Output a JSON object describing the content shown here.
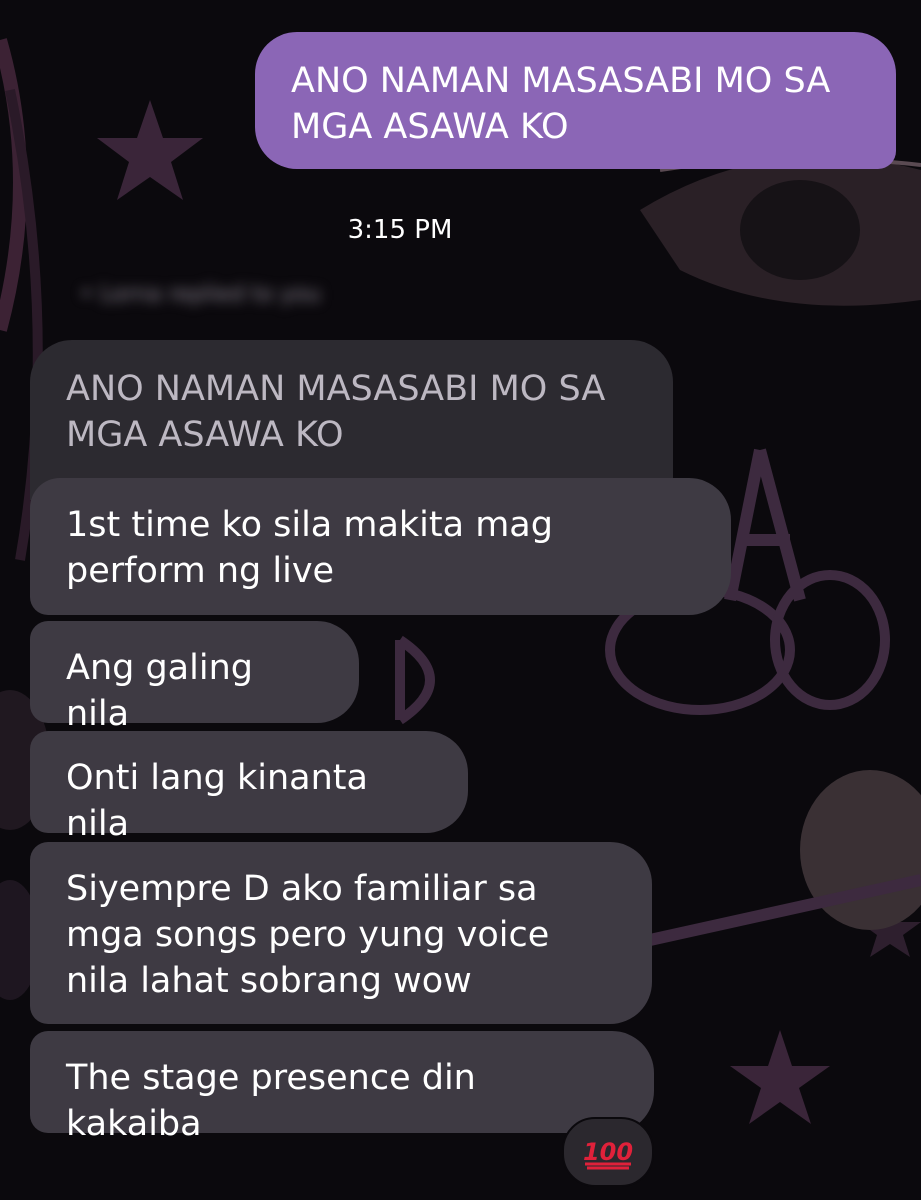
{
  "sent_message": "ANO NAMAN MASASABI MO SA MGA ASAWA KO",
  "timestamp": "3:15 PM",
  "reply_context": {
    "name_blurred": "• Lorna replied to you",
    "quoted_text": "ANO NAMAN MASASABI MO SA MGA ASAWA KO"
  },
  "received_messages": [
    "1st time ko sila makita mag perform ng live",
    "Ang galing nila",
    "Onti lang kinanta nila",
    "Siyempre D ako familiar sa mga songs pero yung voice nila lahat sobrang wow",
    "The stage presence din kakaiba"
  ],
  "reaction": {
    "icon": "hundred-points-icon",
    "text": "100"
  },
  "colors": {
    "sent_bubble": "#8b66b6",
    "received_bubble": "#3e3a43",
    "quoted_bubble": "#2c2a30",
    "background": "#0b090d",
    "reaction": "#e0213a"
  }
}
